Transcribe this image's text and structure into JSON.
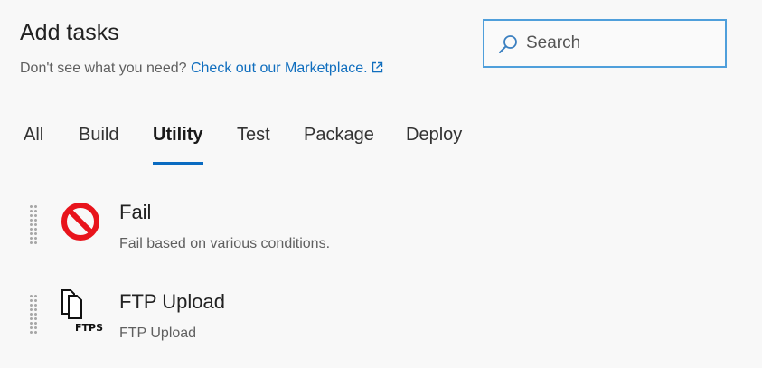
{
  "header": {
    "title": "Add tasks",
    "subtitle_text": "Don't see what you need? ",
    "marketplace_link": "Check out our Marketplace.",
    "external_icon": "external-link-icon"
  },
  "search": {
    "placeholder": "Search",
    "value": "",
    "icon": "search-icon"
  },
  "tabs": [
    {
      "label": "All",
      "active": false
    },
    {
      "label": "Build",
      "active": false
    },
    {
      "label": "Utility",
      "active": true
    },
    {
      "label": "Test",
      "active": false
    },
    {
      "label": "Package",
      "active": false
    },
    {
      "label": "Deploy",
      "active": false
    }
  ],
  "tasks": [
    {
      "name": "Fail",
      "description": "Fail based on various conditions.",
      "icon": "no-entry-icon"
    },
    {
      "name": "FTP Upload",
      "description": "FTP Upload",
      "icon": "ftps-icon",
      "icon_text": "FTPS"
    }
  ],
  "colors": {
    "accent": "#0a6bc1",
    "link": "#106ebe",
    "search_border": "#4f9fdb",
    "fail_red": "#e8141c"
  }
}
